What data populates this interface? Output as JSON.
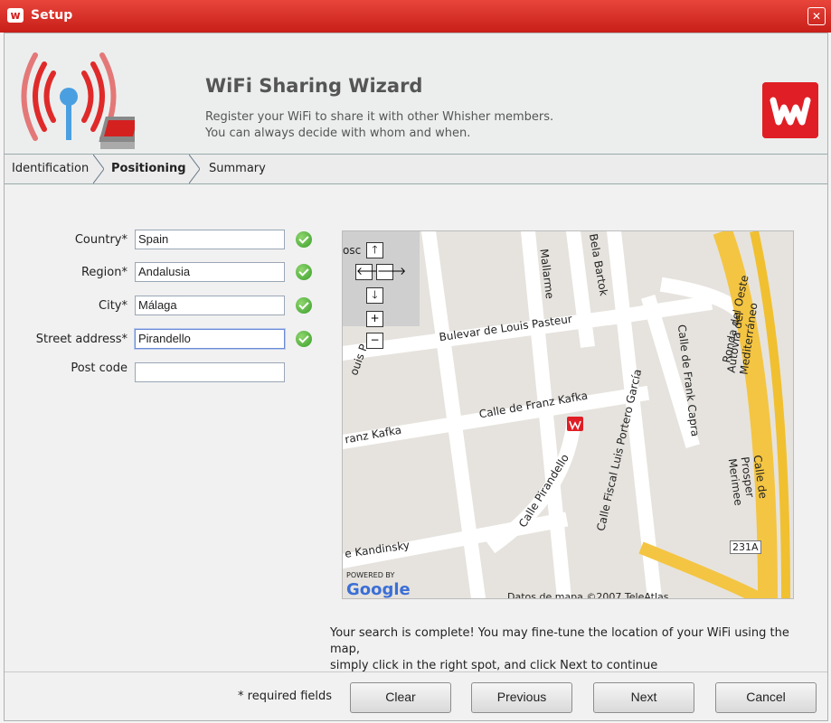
{
  "window": {
    "title": "Setup",
    "close_glyph": "✕"
  },
  "header": {
    "title": "WiFi Sharing Wizard",
    "subtitle_line1": "Register your WiFi to share it with other Whisher members.",
    "subtitle_line2": "You can always decide with whom and when.",
    "brand_color": "#e01e25"
  },
  "steps": [
    {
      "label": "Identification",
      "active": false
    },
    {
      "label": "Positioning",
      "active": true
    },
    {
      "label": "Summary",
      "active": false
    }
  ],
  "form": {
    "country": {
      "label": "Country*",
      "value": "Spain",
      "valid": true
    },
    "region": {
      "label": "Region*",
      "value": "Andalusia",
      "valid": true
    },
    "city": {
      "label": "City*",
      "value": "Málaga",
      "valid": true
    },
    "street": {
      "label": "Street address*",
      "value": "Pirandello",
      "valid": true
    },
    "postcode": {
      "label": "Post code",
      "value": "",
      "valid": false
    }
  },
  "map": {
    "controls": {
      "up": "🡑",
      "left": "🡐",
      "right": "🡒",
      "down": "🡓",
      "zoom_in": "+",
      "zoom_out": "−"
    },
    "labels": {
      "bulevar": "Bulevar de Louis Pasteur",
      "kafka": "Calle de Franz Kafka",
      "kafka_left": "ranz Kafka",
      "pirandello": "Calle Pirandello",
      "portero": "Calle Fiscal Luis Portero García",
      "capra": "Calle de Frank Capra",
      "mallarme": "Mallarme",
      "bartok": "Bela Bartok",
      "ronda": "Ronda del Oeste",
      "autovia": "Autovía del Mediterráneo",
      "prosper": "Calle de Prosper Merimee",
      "kandinsky": "e Kandinsky",
      "louis": "ouis P",
      "osc": "osc",
      "exit": "231A",
      "powered_by": "POWERED BY",
      "google": "Google",
      "copyright": "Datos de mapa ©2007 TeleAtlas"
    }
  },
  "footer": {
    "message_line1": "Your search is complete! You may fine-tune the location of your WiFi using the map,",
    "message_line2": "simply click in the right spot, and click Next to continue",
    "required_note": "* required fields",
    "buttons": {
      "clear": "Clear",
      "previous": "Previous",
      "next": "Next",
      "cancel": "Cancel"
    }
  }
}
